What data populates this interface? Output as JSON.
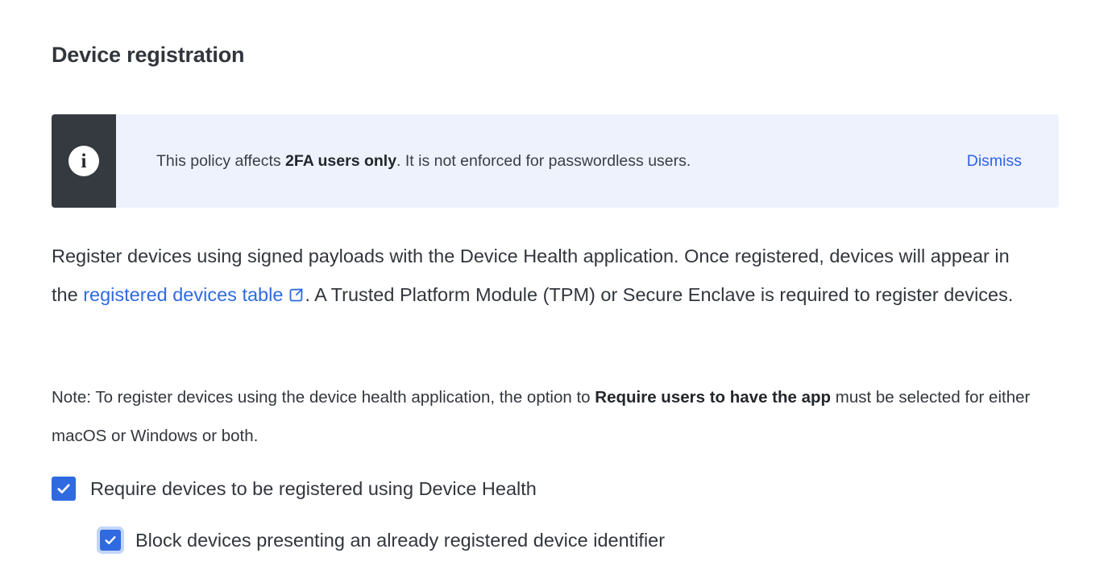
{
  "page": {
    "title": "Device registration"
  },
  "banner": {
    "icon": "info-icon",
    "icon_glyph": "i",
    "text_lead": "This policy affects ",
    "text_bold": "2FA users only",
    "text_tail": ". It is not enforced for passwordless users.",
    "dismiss_label": "Dismiss",
    "background_color": "#eef2fd",
    "icon_background_color": "#343a40",
    "link_color": "#3063e9"
  },
  "description": {
    "part1": "Register devices using signed payloads with the Device Health application. Once registered, devices will appear in the ",
    "link_text": "registered devices table",
    "link_icon": "external-link-icon",
    "part2": ". A Trusted Platform Module (TPM) or Secure Enclave is required to register devices.",
    "link_color": "#2f6ae0"
  },
  "note": {
    "part1": "Note: To register devices using the device health application, the option to ",
    "bold": "Require users to have the app",
    "part2": " must be selected for either macOS or Windows or both."
  },
  "checkboxes": [
    {
      "label": "Require devices to be registered using Device Health",
      "checked": true,
      "focused": false,
      "accent_color": "#2f6ae0"
    },
    {
      "label": "Block devices presenting an already registered device identifier",
      "checked": true,
      "focused": true,
      "accent_color": "#2f6ae0",
      "focus_ring_color": "#c3d5f8"
    }
  ]
}
